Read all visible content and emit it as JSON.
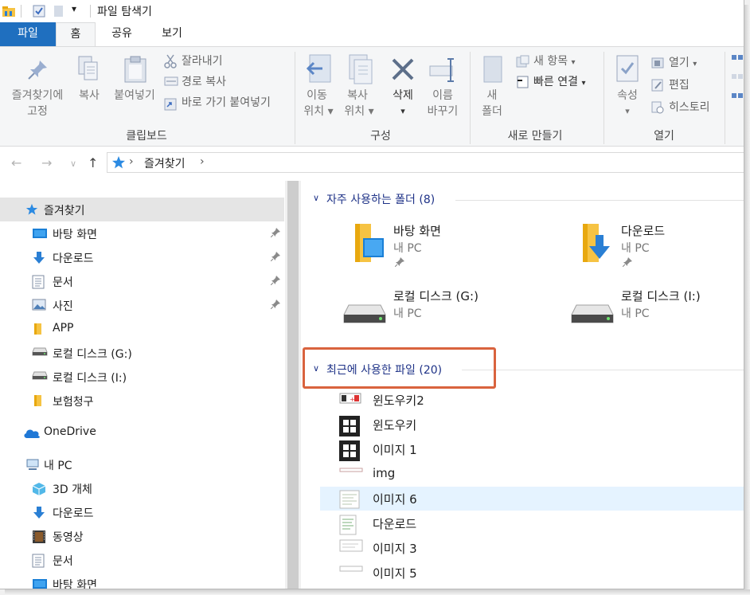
{
  "window": {
    "title": "파일 탐색기"
  },
  "ribbon_tabs": {
    "file": "파일",
    "home": "홈",
    "share": "공유",
    "view": "보기"
  },
  "ribbon": {
    "clipboard": {
      "pin": [
        "즐겨찾기에",
        "고정"
      ],
      "copy": "복사",
      "paste": "붙여넣기",
      "cut": "잘라내기",
      "copy_path": "경로 복사",
      "paste_shortcut": "바로 가기 붙여넣기",
      "group_label": "클립보드"
    },
    "organize": {
      "move_to": [
        "이동",
        "위치"
      ],
      "copy_to": [
        "복사",
        "위치"
      ],
      "delete": "삭제",
      "rename": [
        "이름",
        "바꾸기"
      ],
      "group_label": "구성"
    },
    "new": {
      "new_folder": [
        "새",
        "폴더"
      ],
      "new_item": "새 항목",
      "easy_access": "빠른 연결",
      "group_label": "새로 만들기"
    },
    "open": {
      "properties": "속성",
      "open": "열기",
      "edit": "편집",
      "history": "히스토리",
      "group_label": "열기"
    }
  },
  "address": {
    "location": "즐겨찾기"
  },
  "nav": {
    "quick_access": "즐겨찾기",
    "items": [
      {
        "label": "바탕 화면",
        "pinned": true,
        "icon": "desktop-icon"
      },
      {
        "label": "다운로드",
        "pinned": true,
        "icon": "download-icon"
      },
      {
        "label": "문서",
        "pinned": true,
        "icon": "document-icon"
      },
      {
        "label": "사진",
        "pinned": true,
        "icon": "picture-icon"
      },
      {
        "label": "APP",
        "pinned": false,
        "icon": "folder-icon"
      },
      {
        "label": "로컬 디스크 (G:)",
        "pinned": false,
        "icon": "drive-icon"
      },
      {
        "label": "로컬 디스크 (I:)",
        "pinned": false,
        "icon": "drive-icon"
      },
      {
        "label": "보험청구",
        "pinned": false,
        "icon": "folder-icon"
      }
    ],
    "onedrive": "OneDrive",
    "this_pc": "내 PC",
    "pc_items": [
      {
        "label": "3D 개체",
        "icon": "3d-objects-icon"
      },
      {
        "label": "다운로드",
        "icon": "download-icon"
      },
      {
        "label": "동영상",
        "icon": "video-icon"
      },
      {
        "label": "문서",
        "icon": "document-icon"
      },
      {
        "label": "바탕 화면",
        "icon": "desktop-icon"
      }
    ]
  },
  "frequent": {
    "header": "자주 사용하는 폴더 (8)",
    "tiles": [
      {
        "name": "바탕 화면",
        "sub": "내 PC"
      },
      {
        "name": "다운로드",
        "sub": "내 PC"
      },
      {
        "name": "로컬 디스크 (G:)",
        "sub": "내 PC"
      },
      {
        "name": "로컬 디스크 (I:)",
        "sub": "내 PC"
      }
    ]
  },
  "recent": {
    "header": "최근에 사용한 파일 (20)",
    "files": [
      {
        "name": "윈도우키2"
      },
      {
        "name": "윈도우키"
      },
      {
        "name": "이미지 1"
      },
      {
        "name": "img"
      },
      {
        "name": "이미지 6"
      },
      {
        "name": "다운로드"
      },
      {
        "name": "이미지 3"
      },
      {
        "name": "이미지 5"
      }
    ]
  },
  "colors": {
    "accent": "#1f6fbf",
    "highlight_box": "#d9633e",
    "section_header": "#1e3287"
  }
}
